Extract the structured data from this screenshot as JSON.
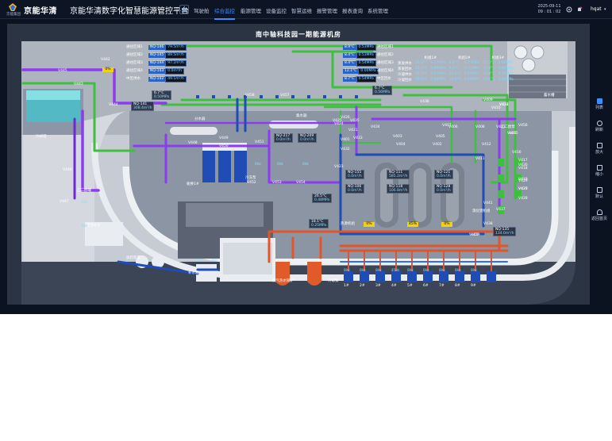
{
  "header": {
    "logo_caption": "京能集团",
    "brand": "京能华清",
    "platform_title": "京能华清数字化智慧能源管控平台",
    "nav": [
      {
        "label": "驾驶舱",
        "active": false
      },
      {
        "label": "综合监控",
        "active": true
      },
      {
        "label": "能源管理",
        "active": false
      },
      {
        "label": "设备监控",
        "active": false
      },
      {
        "label": "智慧运维",
        "active": false
      },
      {
        "label": "报警管理",
        "active": false
      },
      {
        "label": "报表查询",
        "active": false
      },
      {
        "label": "系统管理",
        "active": false
      }
    ],
    "date": "2025-09-11",
    "time": "09 : 01 : 02",
    "user": "hqat"
  },
  "stage": {
    "title": "南中轴科技园一期能源机房",
    "areas": {
      "cooling_tower": "冷却塔",
      "storage_tank": "蓄水槽",
      "constant_pressure": "定压补水",
      "ethylene_tank": "乙二醇罐",
      "dosing": "加药装置",
      "water_tank": "补水箱",
      "splitter": "分水器",
      "collector": "集水器",
      "plate_hx": "板换1#",
      "chiller_hot_pump": "热源机组",
      "cold_pump": "冷冻泵",
      "cooling_pump": "冷却泵",
      "heat_pump": "溴化锂机组",
      "boiler": "燃气热水锅炉",
      "ice_pump": "乙二醇泵"
    },
    "meters_left": [
      {
        "name": "NQ-146",
        "value": "79.5m³/h",
        "label": "通往区域1"
      },
      {
        "name": "NQ-145",
        "value": "89.5m³/h",
        "label": "通往区域2"
      },
      {
        "name": "NQ-144",
        "value": "97.2m³/h",
        "label": "通往区域3"
      },
      {
        "name": "NQ-143",
        "value": "0.0m³/h",
        "label": "通往区域4"
      },
      {
        "name": "NQ-142",
        "value": "49.1m³/h",
        "label": "中区供水"
      }
    ],
    "meters_right": [
      {
        "name": "8.9°C",
        "value": "0.53MPa",
        "label": "通往区域1"
      },
      {
        "name": "8.4°C",
        "value": "0.53MPa",
        "label": "通往区域2"
      },
      {
        "name": "8.4°C",
        "value": "0.54MPa",
        "label": "通往区域3"
      },
      {
        "name": "12.1°C",
        "value": "0.00MPa",
        "label": "通往区域4"
      },
      {
        "name": "8.7°C",
        "value": "0.54MPa",
        "label": "中区回水"
      }
    ],
    "param_table": {
      "headers": [
        "",
        "机组1#",
        "机组2#",
        "机组3#"
      ],
      "rows": [
        [
          "蒸发供水",
          "15.4°C",
          "0.72MPa",
          "6.8°C",
          "0.73MPa",
          "15.2°C",
          "0.00MPa"
        ],
        [
          "蒸发回水",
          "12.1°C",
          "0.89MPa",
          "8.9°C",
          "0.71MPa",
          "15.9°C",
          "0.00MPa"
        ],
        [
          "冷凝供水",
          "22.2°C",
          "0.17MPa",
          "26.1°C",
          "0.19MPa",
          "22.0°C",
          "0.00MPa"
        ],
        [
          "冷凝回水",
          "19.0°C",
          "0.00MPa",
          "18.5°C",
          "0.16MPa",
          "19.5°C",
          "0.00MPa"
        ]
      ]
    },
    "flow_meters": [
      {
        "name": "NQ-141",
        "value": "308.4m³/h"
      },
      {
        "name": "NQ-217",
        "value": "0.0m³/h"
      },
      {
        "name": "NQ-209",
        "value": "0.0m³/h"
      },
      {
        "name": "NQ-155",
        "value": "0.0m³/h"
      },
      {
        "name": "NQ-111",
        "value": "585.2m³/h"
      },
      {
        "name": "NQ-121",
        "value": "0.0m³/h"
      },
      {
        "name": "NQ-106",
        "value": "0.0m³/h"
      },
      {
        "name": "NQ-118",
        "value": "106.8m³/h"
      },
      {
        "name": "NQ-128",
        "value": "0.0m³/h"
      },
      {
        "name": "NQ-135",
        "value": "134.0m³/h"
      }
    ],
    "temps": [
      {
        "t": "6.7°C",
        "p": "0.50MPa"
      },
      {
        "t": "6.7°C",
        "p": "0.56MPa"
      },
      {
        "t": "26.5°C",
        "p": "0.48MPa"
      },
      {
        "t": "18.1°C",
        "p": "0.25MPa"
      }
    ],
    "load_badges": [
      "0%",
      "0%",
      "45%",
      "0%"
    ],
    "valves": [
      "V445",
      "V442",
      "V443",
      "V444",
      "V446",
      "V447",
      "V448",
      "V449",
      "V450",
      "V451",
      "V452",
      "V453",
      "V454",
      "V456",
      "V434",
      "V435",
      "V436",
      "V403",
      "V404",
      "V405",
      "V406",
      "V407",
      "V408",
      "V409",
      "V410",
      "V411",
      "V412",
      "V413",
      "V414",
      "V415",
      "V416",
      "V417",
      "V418",
      "V419",
      "V420",
      "V421",
      "V422",
      "V423",
      "V424",
      "V425",
      "V426",
      "V427",
      "V428",
      "V429",
      "V430",
      "V431",
      "V432",
      "V433",
      "V437",
      "V438",
      "V439",
      "V440",
      "V441",
      "V457",
      "V458",
      "V401",
      "V402"
    ],
    "pumps": [
      "1#",
      "2#",
      "3#",
      "4#",
      "5#",
      "6#",
      "7#",
      "8#",
      "9#"
    ],
    "hz": "0Hz",
    "hz_active": "45Hz"
  },
  "toolbar": [
    {
      "label": "列表",
      "icon": "list-icon"
    },
    {
      "label": "刷新",
      "icon": "refresh-icon"
    },
    {
      "label": "放大",
      "icon": "zoom-in-icon"
    },
    {
      "label": "缩小",
      "icon": "zoom-out-icon"
    },
    {
      "label": "默认",
      "icon": "fit-icon"
    },
    {
      "label": "返回首页",
      "icon": "home-icon"
    }
  ]
}
